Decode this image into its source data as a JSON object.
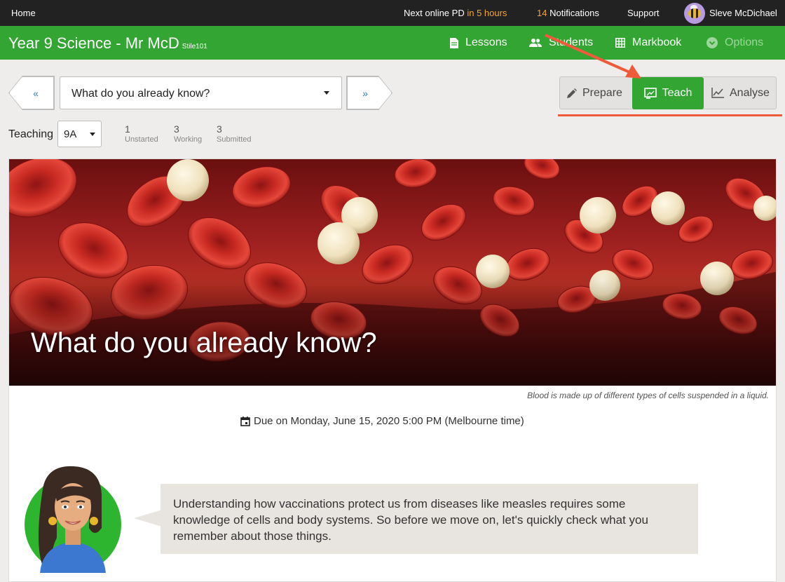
{
  "topbar": {
    "home": "Home",
    "pd_prefix": "Next online PD",
    "pd_time": "in 5 hours",
    "notif_count": "14",
    "notif_label": "Notifications",
    "support": "Support",
    "user_name": "Sleve McDichael"
  },
  "course": {
    "title": "Year 9 Science - Mr McD",
    "subtitle": "Stile101",
    "nav": {
      "lessons": "Lessons",
      "students": "Students",
      "markbook": "Markbook",
      "options": "Options"
    }
  },
  "toolbar": {
    "prev_label": "«",
    "next_label": "»",
    "lesson_selected": "What do you already know?",
    "modes": {
      "prepare": "Prepare",
      "teach": "Teach",
      "analyse": "Analyse"
    }
  },
  "teaching": {
    "label": "Teaching",
    "class": "9A",
    "stats": [
      {
        "count": "1",
        "label": "Unstarted"
      },
      {
        "count": "3",
        "label": "Working"
      },
      {
        "count": "3",
        "label": "Submitted"
      }
    ]
  },
  "lesson": {
    "hero_title": "What do you already know?",
    "caption": "Blood is made up of different types of cells suspended in a liquid.",
    "due": "Due on Monday, June 15, 2020 5:00 PM (Melbourne time)",
    "speech": "Understanding how vaccinations protect us from diseases like measles requires some knowledge of cells and body systems. So before we move on, let's quickly check what you remember about those things."
  },
  "colors": {
    "brand_green": "#33a532",
    "topbar_bg": "#222222",
    "highlight_orange": "#f2a63a",
    "annotation_red": "#ef5b3a",
    "link_blue": "#2b7ec0"
  }
}
